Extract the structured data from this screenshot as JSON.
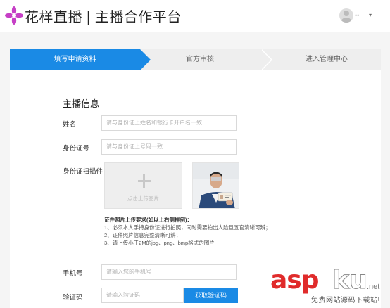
{
  "header": {
    "brand": "花样直播 | 主播合作平台",
    "user_name": "••",
    "user_menu_caret": "▾"
  },
  "steps": [
    {
      "label": "填写申请资料",
      "active": true
    },
    {
      "label": "官方审核",
      "active": false
    },
    {
      "label": "进入管理中心",
      "active": false
    }
  ],
  "form": {
    "section_title": "主播信息",
    "name": {
      "label": "姓名",
      "placeholder": "请与身份证上姓名和银行卡开户名一致"
    },
    "id_number": {
      "label": "身份证号",
      "placeholder": "请与身份证上号码一致"
    },
    "id_scan": {
      "label": "身份证扫描件",
      "upload_text": "点击上传图片"
    },
    "upload_notes": [
      "证件照片上传要求(如以上右侧样例)：",
      "1、必须本人手持身份证进行拍照，同时需要拍出人脸且五官清晰可辨；",
      "2、证件照片信息完整清晰可辨；",
      "3、请上传小于2M的jpg、png、bmp格式的图片"
    ],
    "phone": {
      "label": "手机号",
      "placeholder": "请输入您的手机号"
    },
    "code": {
      "label": "验证码",
      "placeholder": "请输入验证码",
      "button": "获取验证码"
    }
  },
  "watermark": {
    "asp": "asp",
    "ku": "ku",
    "net": ".net",
    "sub": "免费网站源码下载站!"
  },
  "colors": {
    "accent": "#1a8ae5",
    "logo": "#c63fc6"
  }
}
